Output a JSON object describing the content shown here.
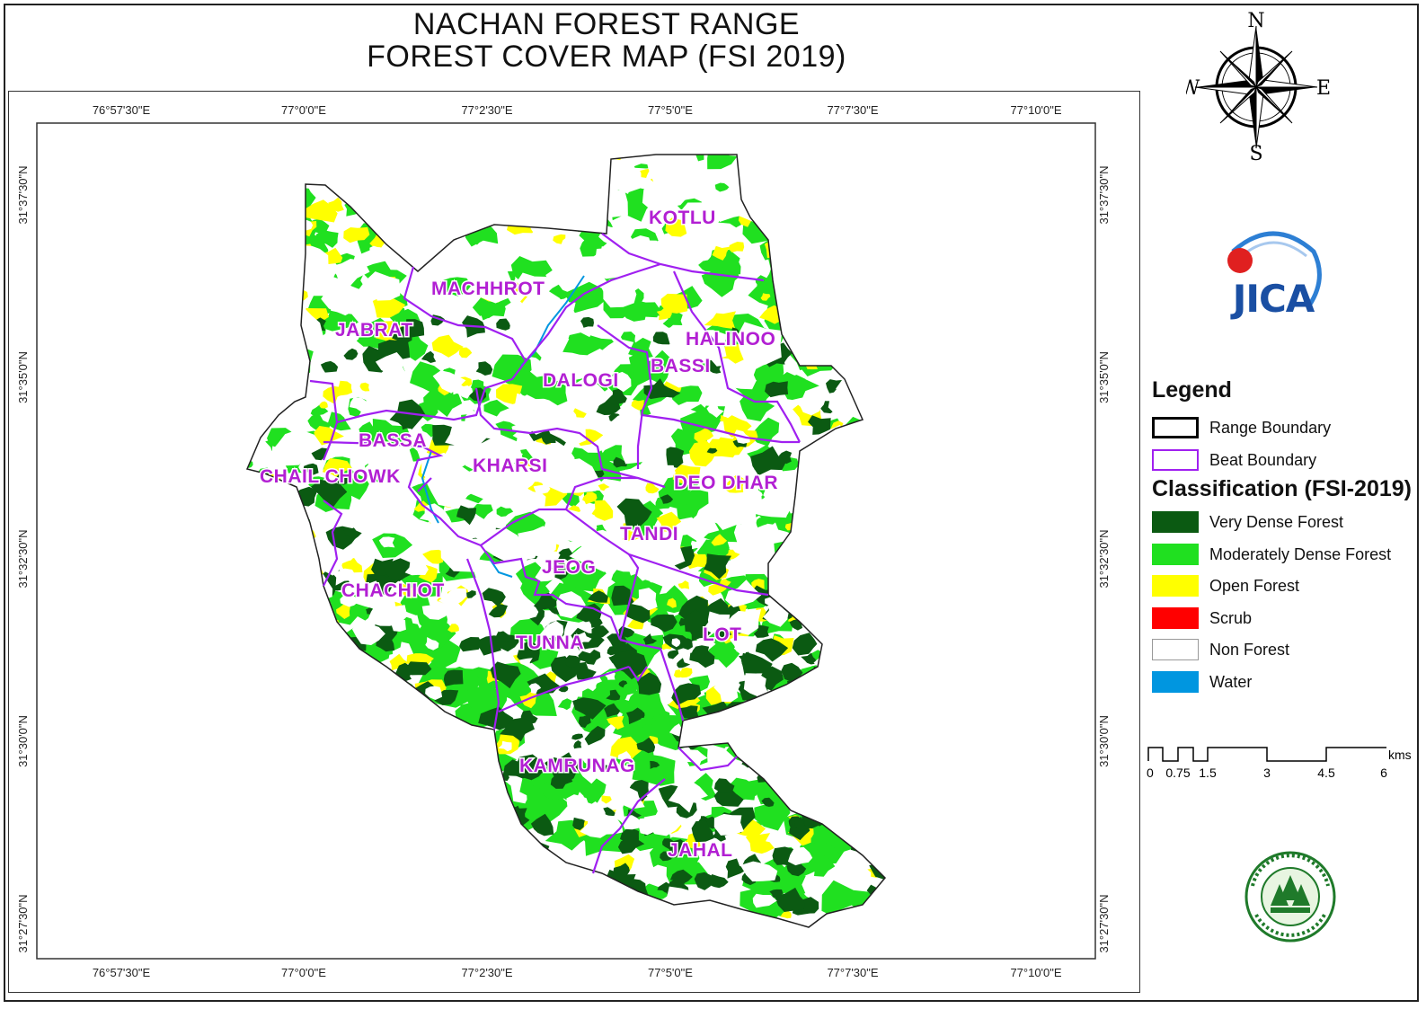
{
  "title_line1": "NACHAN FOREST RANGE",
  "title_line2": "FOREST COVER MAP (FSI 2019)",
  "graticule": {
    "top_lon": [
      "76°57'30\"E",
      "77°0'0\"E",
      "77°2'30\"E",
      "77°5'0\"E",
      "77°7'30\"E",
      "77°10'0\"E"
    ],
    "bottom_lon": [
      "76°57'30\"E",
      "77°0'0\"E",
      "77°2'30\"E",
      "77°5'0\"E",
      "77°7'30\"E",
      "77°10'0\"E"
    ],
    "left_lat": [
      "31°37'30\"N",
      "31°35'0\"N",
      "31°32'30\"N",
      "31°30'0\"N",
      "31°27'30\"N"
    ],
    "right_lat": [
      "31°37'30\"N",
      "31°35'0\"N",
      "31°32'30\"N",
      "31°30'0\"N",
      "31°27'30\"N"
    ]
  },
  "beats": [
    "KOTLU",
    "MACHHROT",
    "JABRAT",
    "HALINOO",
    "BASSI",
    "DALOGI",
    "BASSA",
    "CHAIL CHOWK",
    "KHARSI",
    "DEO DHAR",
    "TANDI",
    "JEOG",
    "CHACHIOT",
    "TUNNA",
    "LOT",
    "KAMRUNAG",
    "JAHAL"
  ],
  "compass": {
    "n": "N",
    "s": "S",
    "e": "E",
    "w": "W"
  },
  "logo_text": "JICA",
  "legend": {
    "title": "Legend",
    "boundaries": [
      {
        "label": "Range Boundary",
        "color": "#000000"
      },
      {
        "label": "Beat Boundary",
        "color": "#a020f0"
      }
    ],
    "classification_title": "Classification (FSI-2019)",
    "classes": [
      {
        "label": "Very Dense Forest",
        "color": "#0b5a12"
      },
      {
        "label": "Moderately Dense Forest",
        "color": "#20e020"
      },
      {
        "label": "Open Forest",
        "color": "#ffff00"
      },
      {
        "label": "Scrub",
        "color": "#ff0000"
      },
      {
        "label": "Non Forest",
        "color": "#ffffff"
      },
      {
        "label": "Water",
        "color": "#0096e0"
      }
    ]
  },
  "scale": {
    "ticks": [
      "0",
      "0.75",
      "1.5",
      "3",
      "4.5",
      "6"
    ],
    "unit": "kms"
  }
}
